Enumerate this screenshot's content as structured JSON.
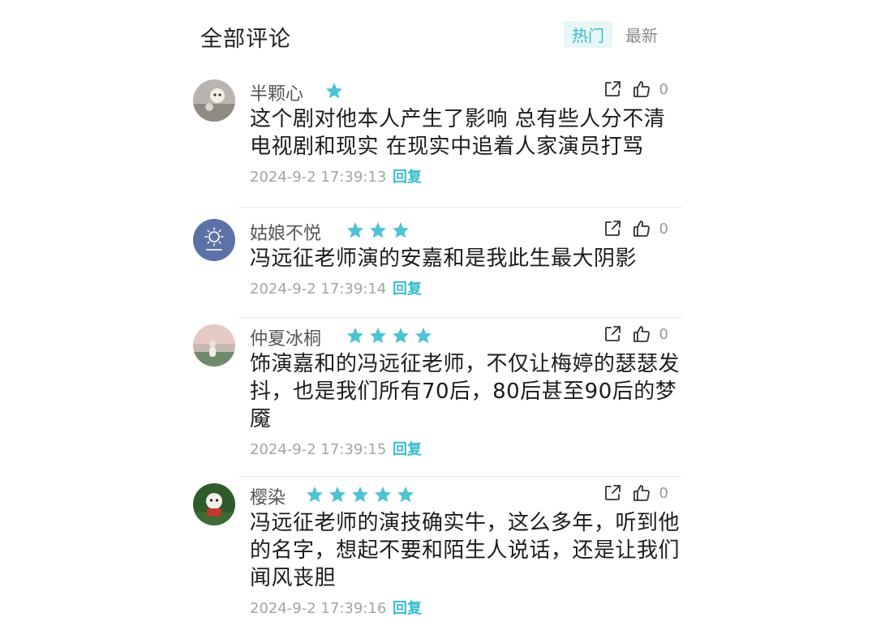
{
  "header": {
    "title": "全部评论",
    "tabs": [
      {
        "label": "热门",
        "active": true
      },
      {
        "label": "最新",
        "active": false
      }
    ]
  },
  "colors": {
    "accent": "#3cbcd0",
    "star": "#4dc3d4"
  },
  "comments": [
    {
      "username": "半颗心",
      "rating": 1,
      "likes": "0",
      "text": "这个剧对他本人产生了影响 总有些人分不清电视剧和现实 在现实中追着人家演员打骂",
      "timestamp": "2024-9-2 17:39:13",
      "reply_label": "回复"
    },
    {
      "username": "姑娘不悦",
      "rating": 3,
      "likes": "0",
      "text": "冯远征老师演的安嘉和是我此生最大阴影",
      "timestamp": "2024-9-2 17:39:14",
      "reply_label": "回复"
    },
    {
      "username": "仲夏冰桐",
      "rating": 4,
      "likes": "0",
      "text": "饰演嘉和的冯远征老师，不仅让梅婷的瑟瑟发抖，也是我们所有70后，80后甚至90后的梦魇",
      "timestamp": "2024-9-2 17:39:15",
      "reply_label": "回复"
    },
    {
      "username": "樱染",
      "rating": 5,
      "likes": "0",
      "text": "冯远征老师的演技确实牛，这么多年，听到他的名字，想起不要和陌生人说话，还是让我们闻风丧胆",
      "timestamp": "2024-9-2 17:39:16",
      "reply_label": "回复"
    }
  ]
}
